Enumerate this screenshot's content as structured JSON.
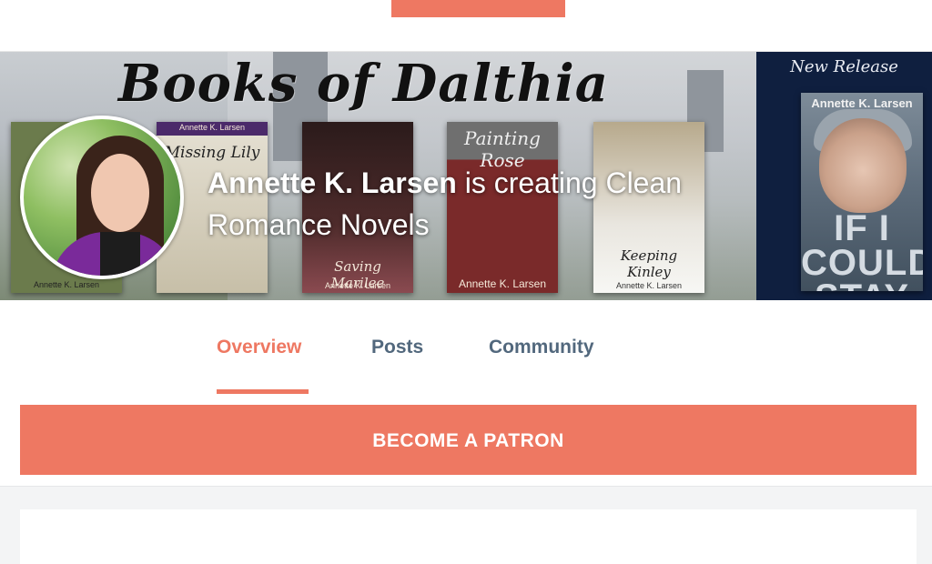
{
  "colors": {
    "accent": "#ee7862",
    "tab_inactive": "#52687d",
    "background": "#f3f4f5",
    "new_release_panel": "#0f1f3f"
  },
  "banner": {
    "title": "Books of Dalthia",
    "covers": [
      {
        "author": "Annette K. Larsen",
        "title": "",
        "bg": "#6b7b4c"
      },
      {
        "author": "Annette K. Larsen",
        "title": "Missing Lily",
        "bg": "#4b2a6a"
      },
      {
        "author": "Annette K. Larsen",
        "title": "Saving Marilee",
        "bg": "#2b1b1b"
      },
      {
        "author": "Annette K. Larsen",
        "title": "Painting Rose",
        "bg": "#7a2a2a"
      },
      {
        "author": "Annette K. Larsen",
        "title": "Keeping Kinley",
        "bg": "#b7a98c"
      }
    ],
    "new_release": {
      "label": "New Release",
      "author": "Annette K. Larsen",
      "title_lines": [
        "IF I",
        "COULD",
        "STAY"
      ]
    }
  },
  "creator": {
    "name": "Annette K. Larsen",
    "tagline": "is creating Clean Romance Novels",
    "avatar_icon": "profile-photo"
  },
  "tabs": [
    {
      "label": "Overview",
      "active": true
    },
    {
      "label": "Posts",
      "active": false
    },
    {
      "label": "Community",
      "active": false
    }
  ],
  "actions": {
    "become_patron": "BECOME A PATRON"
  }
}
